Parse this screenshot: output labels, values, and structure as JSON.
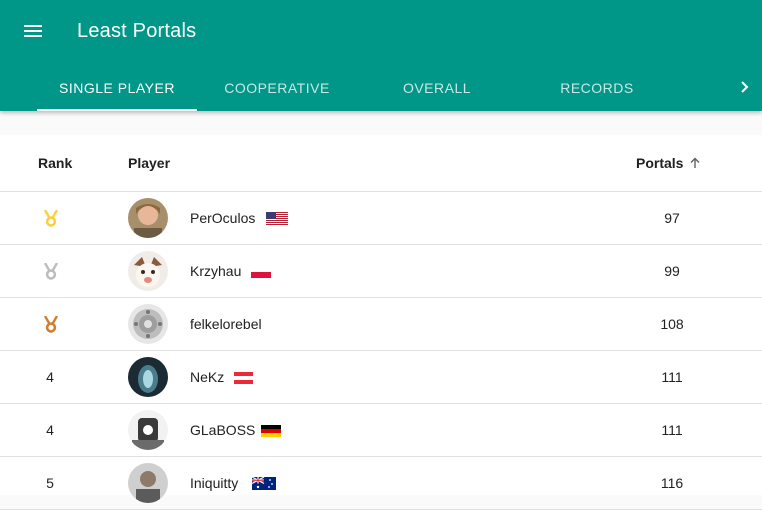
{
  "app": {
    "title": "Least Portals"
  },
  "tabs": [
    {
      "label": "SINGLE PLAYER",
      "active": true
    },
    {
      "label": "COOPERATIVE",
      "active": false
    },
    {
      "label": "OVERALL",
      "active": false
    },
    {
      "label": "RECORDS",
      "active": false
    }
  ],
  "table": {
    "headers": {
      "rank": "Rank",
      "player": "Player",
      "portals": "Portals"
    },
    "rows": [
      {
        "rank": "",
        "medal": "gold",
        "player": "PerOculos",
        "country": "United States",
        "portals": "97"
      },
      {
        "rank": "",
        "medal": "silver",
        "player": "Krzyhau",
        "country": "Poland",
        "portals": "99"
      },
      {
        "rank": "",
        "medal": "bronze",
        "player": "felkelorebel",
        "country": "",
        "portals": "108"
      },
      {
        "rank": "4",
        "medal": "",
        "player": "NeKz",
        "country": "Austria",
        "portals": "111"
      },
      {
        "rank": "4",
        "medal": "",
        "player": "GLaBOSS",
        "country": "Germany",
        "portals": "111"
      },
      {
        "rank": "5",
        "medal": "",
        "player": "Iniquitty",
        "country": "Australia",
        "portals": "116"
      }
    ]
  },
  "colors": {
    "primary": "#009688",
    "gold": "#F9D03F",
    "silver": "#BDBDBD",
    "bronze": "#CD7F32"
  },
  "icons": {
    "menu": "menu-icon",
    "sort": "arrow-up-icon",
    "tab_scroll": "chevron-right-icon",
    "medal": "medal-icon"
  }
}
